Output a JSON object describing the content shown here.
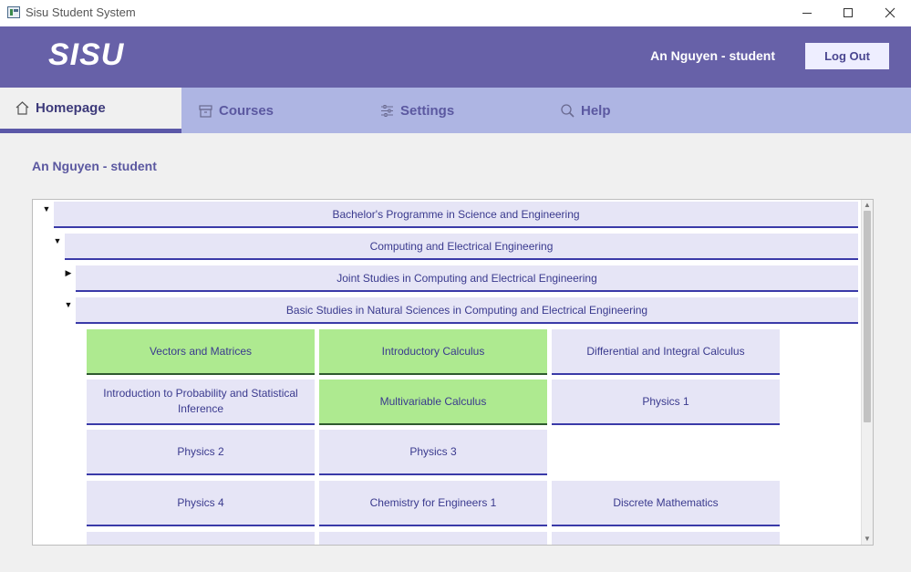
{
  "window": {
    "title": "Sisu Student System",
    "icons": [
      "app-icon",
      "minimize-icon",
      "maximize-icon",
      "close-icon"
    ]
  },
  "header": {
    "logo": "SISU",
    "user": "An Nguyen - student",
    "logout_label": "Log Out"
  },
  "tabs": [
    {
      "label": "Homepage",
      "icon": "home-icon",
      "active": true
    },
    {
      "label": "Courses",
      "icon": "archive-icon",
      "active": false
    },
    {
      "label": "Settings",
      "icon": "sliders-icon",
      "active": false
    },
    {
      "label": "Help",
      "icon": "search-icon",
      "active": false
    }
  ],
  "main": {
    "heading": "An Nguyen - student"
  },
  "tree": {
    "nodes": [
      {
        "label": "Bachelor's Programme in Science and Engineering",
        "expanded": true
      },
      {
        "label": "Computing and Electrical Engineering",
        "expanded": true
      },
      {
        "label": "Joint Studies in Computing and Electrical Engineering",
        "expanded": false
      },
      {
        "label": "Basic Studies in Natural Sciences in Computing and Electrical Engineering",
        "expanded": true
      }
    ],
    "courses": [
      {
        "name": "Vectors and Matrices",
        "completed": true
      },
      {
        "name": "Introductory Calculus",
        "completed": true
      },
      {
        "name": "Differential and Integral Calculus",
        "completed": false
      },
      {
        "name": "Introduction to Probability and Statistical Inference",
        "completed": false
      },
      {
        "name": "Multivariable Calculus",
        "completed": true
      },
      {
        "name": "Physics 1",
        "completed": false
      },
      {
        "name": "Physics 2",
        "completed": false
      },
      {
        "name": "Physics 3",
        "completed": false
      },
      {
        "name": "Physics 4",
        "completed": false
      },
      {
        "name": "Chemistry for Engineers 1",
        "completed": false
      },
      {
        "name": "Discrete Mathematics",
        "completed": false
      }
    ]
  },
  "colors": {
    "header": "#6761a8",
    "tab_bar": "#aeb5e3",
    "completed_course": "#aeea90",
    "course": "#e6e5f6",
    "accent_border": "#3a3aa8"
  }
}
